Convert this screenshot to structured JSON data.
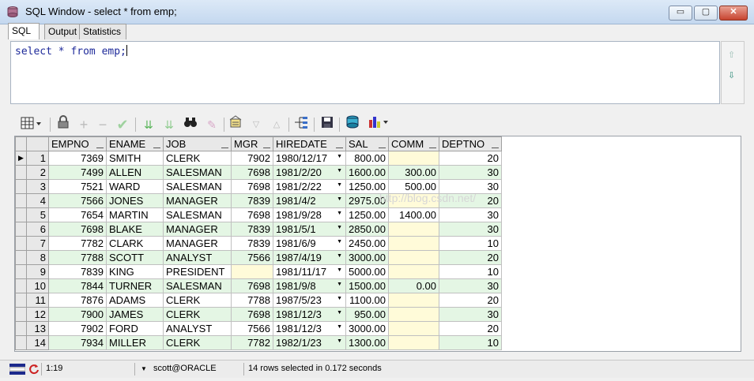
{
  "window": {
    "title": "SQL Window - select * from emp;",
    "buttons": {
      "minimize": "▭",
      "maximize": "▢",
      "close": "✕"
    }
  },
  "tabs": [
    {
      "label": "SQL",
      "active": true
    },
    {
      "label": "Output",
      "active": false
    },
    {
      "label": "Statistics",
      "active": false
    }
  ],
  "editor": {
    "sql": "select * from emp;"
  },
  "icons": {
    "grid_menu": "grid-menu-icon",
    "lock": "lock-icon",
    "add_record": "add-record-icon",
    "delete_record": "delete-record-icon",
    "post_changes": "checkmark-icon",
    "fetch_next": "fetch-next-icon",
    "fetch_all": "fetch-last-icon",
    "find": "binoculars-icon",
    "clear": "eraser-icon",
    "query_by_example": "query-icon",
    "next_page": "arrow-down-icon",
    "prev_page": "arrow-up-icon",
    "single_record": "tree-view-icon",
    "save": "save-icon",
    "export": "export-icon",
    "chart": "chart-icon"
  },
  "grid": {
    "columns": [
      "EMPNO",
      "ENAME",
      "JOB",
      "MGR",
      "HIREDATE",
      "SAL",
      "COMM",
      "DEPTNO"
    ],
    "rows": [
      [
        "1",
        "7369",
        "SMITH",
        "CLERK",
        "7902",
        "1980/12/17",
        "800.00",
        "",
        "20"
      ],
      [
        "2",
        "7499",
        "ALLEN",
        "SALESMAN",
        "7698",
        "1981/2/20",
        "1600.00",
        "300.00",
        "30"
      ],
      [
        "3",
        "7521",
        "WARD",
        "SALESMAN",
        "7698",
        "1981/2/22",
        "1250.00",
        "500.00",
        "30"
      ],
      [
        "4",
        "7566",
        "JONES",
        "MANAGER",
        "7839",
        "1981/4/2",
        "2975.00",
        "",
        "20"
      ],
      [
        "5",
        "7654",
        "MARTIN",
        "SALESMAN",
        "7698",
        "1981/9/28",
        "1250.00",
        "1400.00",
        "30"
      ],
      [
        "6",
        "7698",
        "BLAKE",
        "MANAGER",
        "7839",
        "1981/5/1",
        "2850.00",
        "",
        "30"
      ],
      [
        "7",
        "7782",
        "CLARK",
        "MANAGER",
        "7839",
        "1981/6/9",
        "2450.00",
        "",
        "10"
      ],
      [
        "8",
        "7788",
        "SCOTT",
        "ANALYST",
        "7566",
        "1987/4/19",
        "3000.00",
        "",
        "20"
      ],
      [
        "9",
        "7839",
        "KING",
        "PRESIDENT",
        "",
        "1981/11/17",
        "5000.00",
        "",
        "10"
      ],
      [
        "10",
        "7844",
        "TURNER",
        "SALESMAN",
        "7698",
        "1981/9/8",
        "1500.00",
        "0.00",
        "30"
      ],
      [
        "11",
        "7876",
        "ADAMS",
        "CLERK",
        "7788",
        "1987/5/23",
        "1100.00",
        "",
        "20"
      ],
      [
        "12",
        "7900",
        "JAMES",
        "CLERK",
        "7698",
        "1981/12/3",
        "950.00",
        "",
        "30"
      ],
      [
        "13",
        "7902",
        "FORD",
        "ANALYST",
        "7566",
        "1981/12/3",
        "3000.00",
        "",
        "20"
      ],
      [
        "14",
        "7934",
        "MILLER",
        "CLERK",
        "7782",
        "1982/1/23",
        "1300.00",
        "",
        "10"
      ]
    ]
  },
  "watermark": "http://blog.csdn.net/",
  "status": {
    "position": "1:19",
    "connection": "scott@ORACLE",
    "message": "14 rows selected in 0.172 seconds"
  }
}
